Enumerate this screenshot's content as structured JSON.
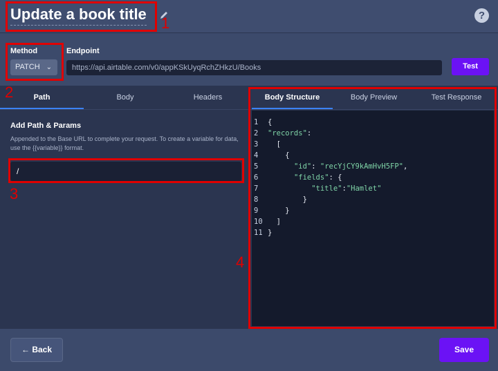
{
  "header": {
    "title": "Update a book title",
    "help": "?"
  },
  "request": {
    "method_label": "Method",
    "method_value": "PATCH",
    "endpoint_label": "Endpoint",
    "endpoint_url": "https://api.airtable.com/v0/appKSkUyqRchZHkzU/Books",
    "test_label": "Test"
  },
  "left_tabs": [
    "Path",
    "Body",
    "Headers"
  ],
  "path_params": {
    "title": "Add Path & Params",
    "description": "Appended to the Base URL to complete your request. To create a variable for data, use the {{variable}} format.",
    "value": "/"
  },
  "right_tabs": [
    "Body Structure",
    "Body Preview",
    "Test Response"
  ],
  "code_lines": [
    "{",
    "\"records\":",
    "  [",
    "    {",
    "      \"id\": \"recYjCY9kAmHvH5FP\",",
    "      \"fields\": {",
    "          \"title\":\"Hamlet\"",
    "        }",
    "    }",
    "  ]",
    "}"
  ],
  "footer": {
    "back_label": "← Back",
    "save_label": "Save"
  },
  "annotations": [
    "1",
    "2",
    "3",
    "4"
  ],
  "colors": {
    "accent": "#6b12f5",
    "annotation": "#e00000",
    "tab_underline": "#3b82f6"
  }
}
